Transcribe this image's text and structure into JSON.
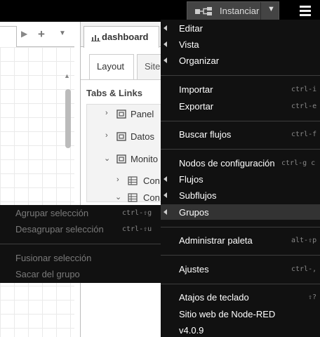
{
  "header": {
    "deploy_label": "Instanciar",
    "deploy_icon": "deploy-icon",
    "menu_icon": "hamburger-menu-icon"
  },
  "workspace": {
    "icons": [
      "scroll-right-icon",
      "add-flow-icon",
      "list-flows-icon"
    ]
  },
  "sidebar": {
    "tab_label": "dashboard",
    "subtabs": [
      "Layout",
      "Site"
    ],
    "section_title": "Tabs & Links",
    "tree": [
      {
        "label": "Panel",
        "expanded": false,
        "level": 1
      },
      {
        "label": "Datos",
        "expanded": false,
        "level": 1
      },
      {
        "label": "Monito",
        "expanded": true,
        "level": 1
      },
      {
        "label": "Con",
        "expanded": false,
        "level": 2
      },
      {
        "label": "Con",
        "expanded": true,
        "level": 2
      }
    ]
  },
  "context_menu_left": {
    "items": [
      {
        "label": "Agrupar selección",
        "shortcut": "ctrl-⇧g",
        "disabled": true
      },
      {
        "label": "Desagrupar selección",
        "shortcut": "ctrl-⇧u",
        "disabled": true
      },
      {
        "label": "Fusionar selección",
        "shortcut": "",
        "disabled": true
      },
      {
        "label": "Sacar del grupo",
        "shortcut": "",
        "disabled": true
      }
    ]
  },
  "context_menu_main": {
    "items": [
      {
        "label": "Editar",
        "shortcut": "",
        "submenu": true
      },
      {
        "label": "Vista",
        "shortcut": "",
        "submenu": true
      },
      {
        "label": "Organizar",
        "shortcut": "",
        "submenu": true
      },
      {
        "label": "Importar",
        "shortcut": "ctrl-i",
        "submenu": false
      },
      {
        "label": "Exportar",
        "shortcut": "ctrl-e",
        "submenu": false
      },
      {
        "label": "Buscar flujos",
        "shortcut": "ctrl-f",
        "submenu": false
      },
      {
        "label": "Nodos de configuración",
        "shortcut": "ctrl-g c",
        "submenu": false
      },
      {
        "label": "Flujos",
        "shortcut": "",
        "submenu": true
      },
      {
        "label": "Subflujos",
        "shortcut": "",
        "submenu": true
      },
      {
        "label": "Grupos",
        "shortcut": "",
        "submenu": true,
        "active": true
      },
      {
        "label": "Administrar paleta",
        "shortcut": "alt-⇧p",
        "submenu": false
      },
      {
        "label": "Ajustes",
        "shortcut": "ctrl-,",
        "submenu": false
      },
      {
        "label": "Atajos de teclado",
        "shortcut": "⇧?",
        "submenu": false
      },
      {
        "label": "Sitio web de Node-RED",
        "shortcut": "",
        "submenu": false
      },
      {
        "label": "v4.0.9",
        "shortcut": "",
        "submenu": false
      }
    ]
  }
}
